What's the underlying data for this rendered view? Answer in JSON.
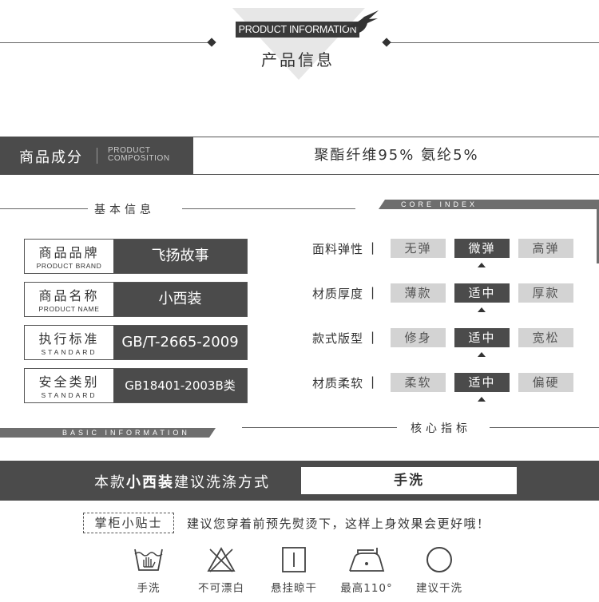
{
  "header": {
    "title_en": "PRODUCT INFORMATION",
    "title_cn": "产品信息"
  },
  "composition": {
    "label_cn": "商品成分",
    "label_en_line1": "PRODUCT",
    "label_en_line2": "COMPOSITION",
    "value": "聚酯纤维95% 氨纶5%"
  },
  "basic_info": {
    "heading_cn": "基本信息",
    "heading_en": "BASIC INFORMATION",
    "items": [
      {
        "label_cn": "商品品牌",
        "label_en": "PRODUCT BRAND",
        "value": "飞扬故事"
      },
      {
        "label_cn": "商品名称",
        "label_en": "PRODUCT NAME",
        "value": "小西装"
      },
      {
        "label_cn": "执行标准",
        "label_en": "STANDARD",
        "value": "GB/T-2665-2009"
      },
      {
        "label_cn": "安全类别",
        "label_en": "STANDARD",
        "value": "GB18401-2003B类"
      }
    ]
  },
  "core_index": {
    "heading_en": "CORE INDEX",
    "heading_cn": "核心指标",
    "rows": [
      {
        "label": "面料弹性",
        "options": [
          "无弹",
          "微弹",
          "高弹"
        ],
        "selected": 1
      },
      {
        "label": "材质厚度",
        "options": [
          "薄款",
          "适中",
          "厚款"
        ],
        "selected": 1
      },
      {
        "label": "款式版型",
        "options": [
          "修身",
          "适中",
          "宽松"
        ],
        "selected": 1
      },
      {
        "label": "材质柔软",
        "options": [
          "柔软",
          "适中",
          "偏硬"
        ],
        "selected": 1
      }
    ],
    "separator": "|"
  },
  "washing": {
    "prefix": "本款",
    "product": "小西装",
    "suffix": "建议洗涤方式",
    "method": "手洗"
  },
  "tips": {
    "label": "掌柜小贴士",
    "text": "建议您穿着前预先熨烫下，这样上身效果会更好哦！"
  },
  "care_icons": [
    {
      "icon": "hand-wash-icon",
      "label": "手洗"
    },
    {
      "icon": "no-bleach-icon",
      "label": "不可漂白"
    },
    {
      "icon": "hang-dry-icon",
      "label": "悬挂晾干"
    },
    {
      "icon": "iron-icon",
      "label": "最高110°"
    },
    {
      "icon": "tumble-dry-icon",
      "label": "建议干洗"
    }
  ],
  "colors": {
    "dark": "#4b4b4b",
    "light": "#d3d3d3",
    "accent_gray": "#6e6e6e"
  }
}
